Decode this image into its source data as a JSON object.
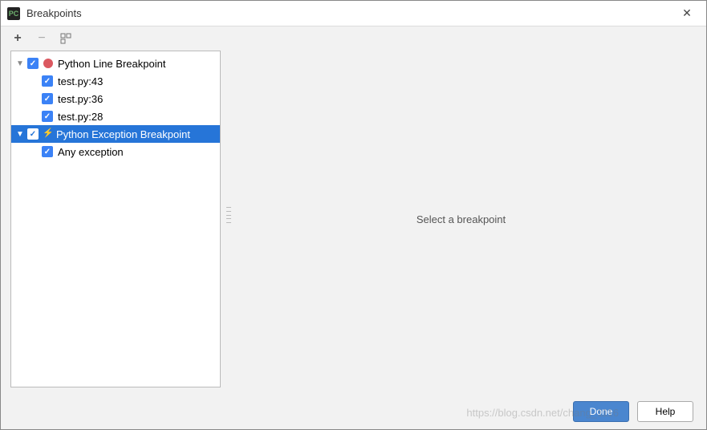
{
  "window": {
    "title": "Breakpoints",
    "icon_text": "PC"
  },
  "toolbar": {
    "add_tooltip": "Add",
    "remove_tooltip": "Remove",
    "group_tooltip": "Group by"
  },
  "tree": {
    "groups": [
      {
        "label": "Python Line Breakpoint",
        "icon": "line",
        "expanded": true,
        "selected": false,
        "checked": true,
        "items": [
          {
            "label": "test.py:43",
            "checked": true
          },
          {
            "label": "test.py:36",
            "checked": true
          },
          {
            "label": "test.py:28",
            "checked": true
          }
        ]
      },
      {
        "label": "Python Exception Breakpoint",
        "icon": "exception",
        "expanded": true,
        "selected": true,
        "checked": true,
        "items": [
          {
            "label": "Any exception",
            "checked": true
          }
        ]
      }
    ]
  },
  "detail": {
    "placeholder": "Select a breakpoint"
  },
  "footer": {
    "done_label": "Done",
    "help_label": "Help"
  },
  "watermark": "https://blog.csdn.net/chang_1116"
}
